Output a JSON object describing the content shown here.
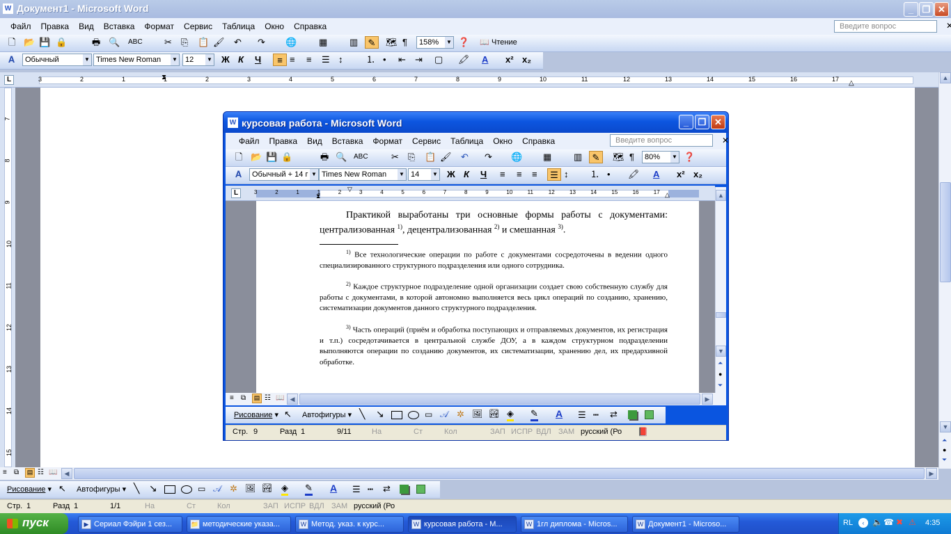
{
  "bg_window": {
    "title": "Документ1 - Microsoft Word",
    "menu": [
      "Файл",
      "Правка",
      "Вид",
      "Вставка",
      "Формат",
      "Сервис",
      "Таблица",
      "Окно",
      "Справка"
    ],
    "ask_placeholder": "Введите вопрос",
    "zoom": "158%",
    "reading": "Чтение",
    "style": "Обычный",
    "font": "Times New Roman",
    "size": "12",
    "ruler": [
      "3",
      "2",
      "1",
      "1",
      "2",
      "3",
      "4",
      "5",
      "6",
      "7",
      "8",
      "9",
      "10",
      "11",
      "12",
      "13",
      "14",
      "15",
      "16",
      "17"
    ],
    "vruler": [
      "7",
      "8",
      "9",
      "10",
      "11",
      "12",
      "13",
      "14",
      "15"
    ],
    "draw": {
      "label": "Рисование",
      "autoshapes": "Автофигуры"
    },
    "status": {
      "page": "Стр.",
      "page_v": "1",
      "section": "Разд",
      "section_v": "1",
      "pages": "1/1",
      "at": "На",
      "line": "Ст",
      "col": "Кол",
      "zap": "ЗАП",
      "ispr": "ИСПР",
      "vdl": "ВДЛ",
      "zam": "ЗАМ",
      "lang": "русский (Ро"
    }
  },
  "fg_window": {
    "title": "курсовая работа - Microsoft Word",
    "menu": [
      "Файл",
      "Правка",
      "Вид",
      "Вставка",
      "Формат",
      "Сервис",
      "Таблица",
      "Окно",
      "Справка"
    ],
    "ask_placeholder": "Введите вопрос",
    "zoom": "80%",
    "style": "Обычный + 14 г",
    "font": "Times New Roman",
    "size": "14",
    "ruler": [
      "3",
      "2",
      "1",
      "1",
      "2",
      "3",
      "4",
      "5",
      "6",
      "7",
      "8",
      "9",
      "10",
      "11",
      "12",
      "13",
      "14",
      "15",
      "16",
      "17"
    ],
    "doc": {
      "para_a": "Практикой выработаны три основные формы работы с документами: централизованная ",
      "sup1": "1)",
      "para_b": ", децентрализованная ",
      "sup2": "2)",
      "para_c": " и смешанная ",
      "sup3": "3)",
      "para_d": ".",
      "fn1_mark": "1)",
      "fn1": " Все технологические операции по работе с документами сосредоточены в ведении одного специализированного структурного подразделения  или одного сотрудника.",
      "fn2_mark": "2)",
      "fn2": " Каждое структурное подразделение одной организации создает свою собственную службу для работы с документами, в которой автономно выполняется весь цикл операций по созданию, хранению, систематизации документов данного структурного подразделения.",
      "fn3_mark": "3)",
      "fn3": " Часть операций (приём и обработка поступающих и отправляемых документов, их регистрация и т.п.) сосредотачивается в центральной службе ДОУ, а в каждом структурном подразделении выполняются операции по созданию документов, их систематизации, хранению дел, их предархивной обработке."
    },
    "draw": {
      "label": "Рисование",
      "autoshapes": "Автофигуры"
    },
    "status": {
      "page": "Стр.",
      "page_v": "9",
      "section": "Разд",
      "section_v": "1",
      "pages": "9/11",
      "at": "На",
      "line": "Ст",
      "col": "Кол",
      "zap": "ЗАП",
      "ispr": "ИСПР",
      "vdl": "ВДЛ",
      "zam": "ЗАМ",
      "lang": "русский (Ро"
    }
  },
  "taskbar": {
    "start": "пуск",
    "tasks": [
      "Сериал Фэйри 1 сез...",
      "методические указа...",
      "Метод. указ. к курс...",
      "курсовая работа - M...",
      "1гл диплома - Micros...",
      "Документ1 - Microso..."
    ],
    "lang": "RL",
    "clock": "4:35"
  }
}
